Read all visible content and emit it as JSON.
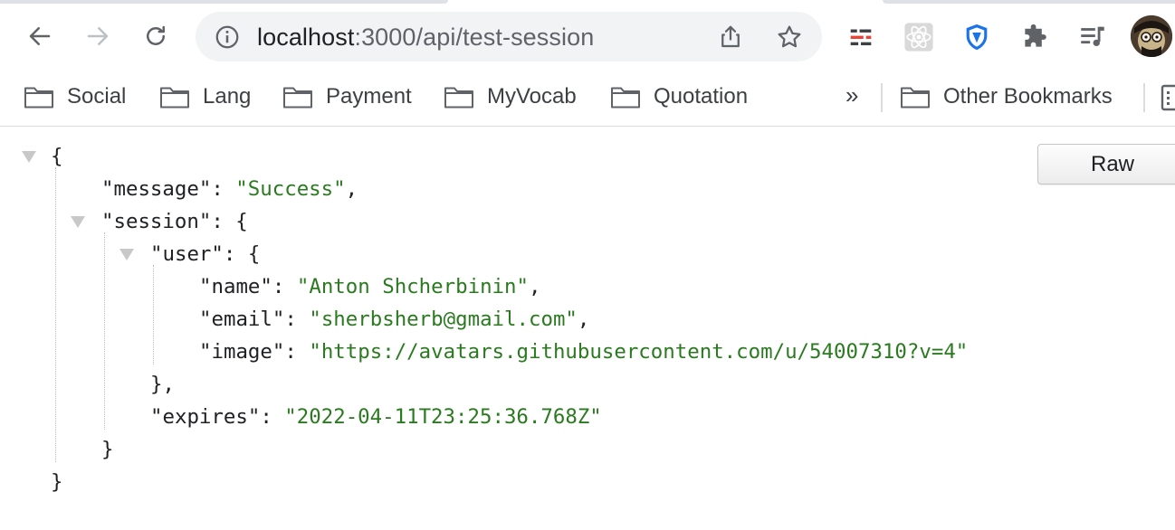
{
  "browser": {
    "url_host": "localhost",
    "url_path": ":3000/api/test-session",
    "bookmarks": [
      "Social",
      "Lang",
      "Payment",
      "MyVocab",
      "Quotation"
    ],
    "more_bookmarks": "»",
    "other_bookmarks": "Other Bookmarks",
    "icons": {
      "back": "arrow-left-icon",
      "forward": "arrow-right-icon",
      "reload": "reload-icon",
      "site_info": "info-icon",
      "share": "share-icon",
      "bookmark": "star-icon",
      "extensions": [
        "tag-toolbar-extension-icon",
        "react-devtools-icon",
        "vpn-shield-icon",
        "puzzle-extensions-icon",
        "media-queue-icon"
      ],
      "folder": "folder-icon",
      "reading_list": "reading-list-icon"
    },
    "colors": {
      "string_value": "#2a7a1f",
      "shield_blue": "#1a73e8",
      "accent_red": "#ea4335"
    }
  },
  "viewer": {
    "raw_button": "Raw",
    "brace_open": "{",
    "brace_close": "}",
    "message_key": "\"message\"",
    "message_value": "\"Success\"",
    "session_key": "\"session\"",
    "user_key": "\"user\"",
    "name_key": "\"name\"",
    "name_value": "\"Anton Shcherbinin\"",
    "email_key": "\"email\"",
    "email_value": "\"sherbsherb@gmail.com\"",
    "image_key": "\"image\"",
    "image_value": "\"https://avatars.githubusercontent.com/u/54007310?v=4\"",
    "user_close": "},",
    "expires_key": "\"expires\"",
    "expires_value": "\"2022-04-11T23:25:36.768Z\""
  }
}
